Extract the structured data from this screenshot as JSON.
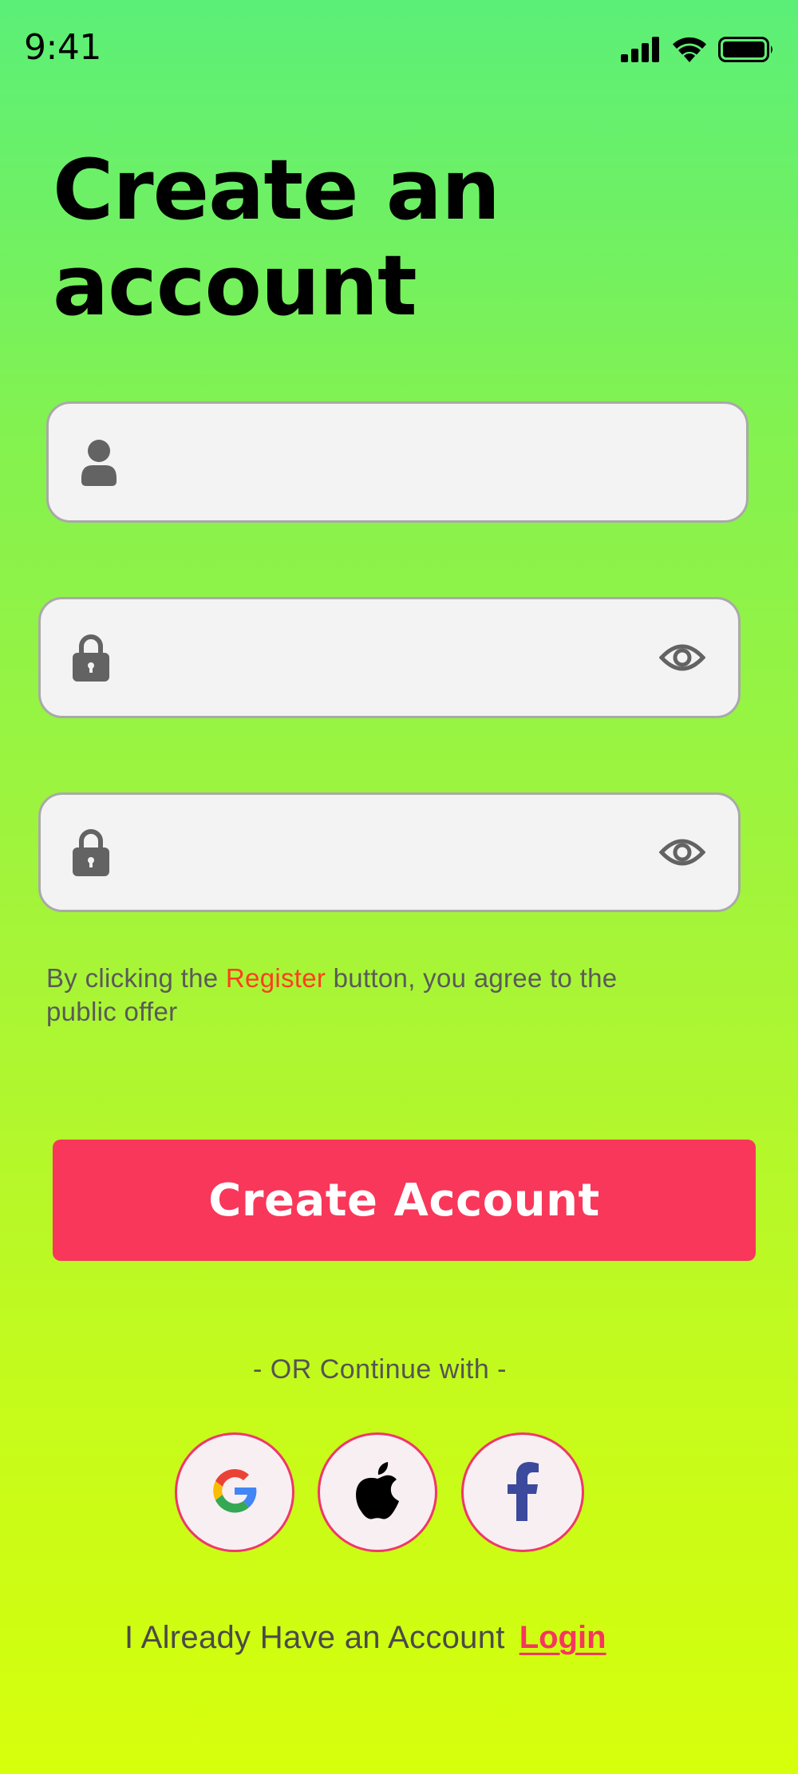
{
  "status_bar": {
    "time": "9:41",
    "icons": [
      "cellular-signal-icon",
      "wifi-icon",
      "battery-icon"
    ]
  },
  "title": "Create an account",
  "form": {
    "username": {
      "value": "",
      "placeholder": "",
      "icon": "user-icon"
    },
    "password": {
      "value": "",
      "placeholder": "",
      "icon": "lock-icon",
      "toggle_icon": "eye-icon"
    },
    "confirm_password": {
      "value": "",
      "placeholder": "",
      "icon": "lock-icon",
      "toggle_icon": "eye-icon"
    }
  },
  "terms": {
    "before": "By clicking the",
    "highlight": "Register",
    "after": "button, you agree to the public offer"
  },
  "create_button_label": "Create Account",
  "or_text": "- OR Continue with -",
  "social": [
    {
      "name": "Google",
      "icon": "google-icon"
    },
    {
      "name": "Apple",
      "icon": "apple-icon"
    },
    {
      "name": "Facebook",
      "icon": "facebook-icon"
    }
  ],
  "login": {
    "question": "I Already Have an Account",
    "link_label": "Login"
  },
  "colors": {
    "accent": "#f8375a",
    "highlight": "#ff3e1d",
    "gradient_top": "#5bef78",
    "gradient_bottom": "#d6ff0c",
    "field_bg": "#f3f3f3"
  }
}
